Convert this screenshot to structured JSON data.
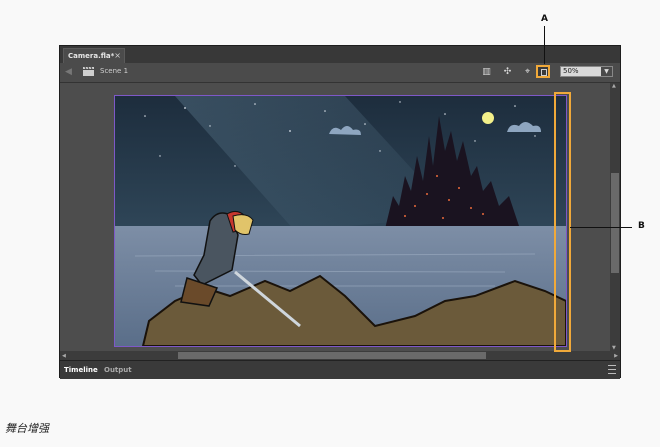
{
  "document_tab": {
    "title": "Camera.fla*",
    "close_glyph": "×"
  },
  "toolbar": {
    "scene_label": "Scene 1",
    "zoom_value": "50%"
  },
  "bottom_panel": {
    "tabs": [
      "Timeline",
      "Output"
    ]
  },
  "callouts": {
    "a": "A",
    "b": "B"
  },
  "caption": "舞台增强"
}
